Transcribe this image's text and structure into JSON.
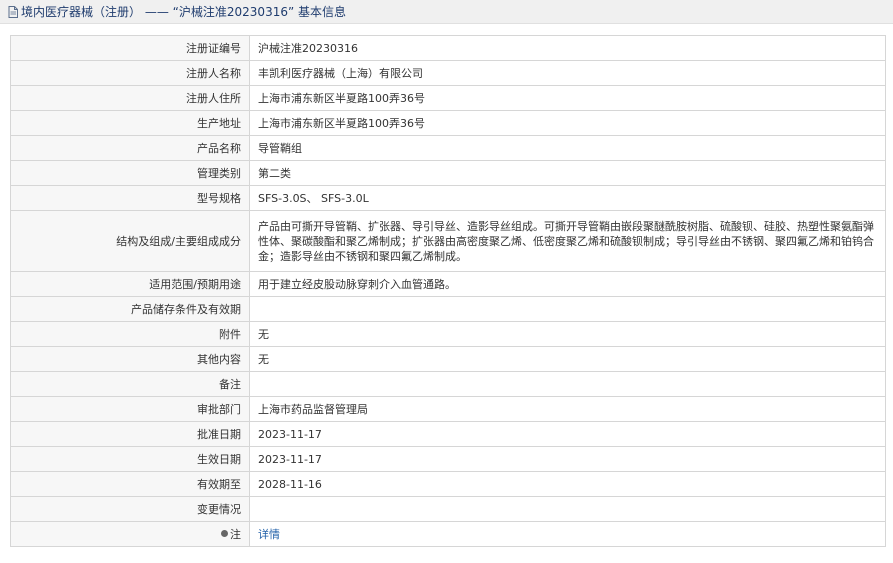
{
  "header": {
    "category": "境内医疗器械（注册）",
    "separator": "——",
    "reg_no_quoted": "“沪械注准20230316”",
    "suffix": "基本信息"
  },
  "rows": [
    {
      "label": "注册证编号",
      "value": "沪械注准20230316"
    },
    {
      "label": "注册人名称",
      "value": "丰凯利医疗器械（上海）有限公司"
    },
    {
      "label": "注册人住所",
      "value": "上海市浦东新区半夏路100弄36号"
    },
    {
      "label": "生产地址",
      "value": "上海市浦东新区半夏路100弄36号"
    },
    {
      "label": "产品名称",
      "value": "导管鞘组"
    },
    {
      "label": "管理类别",
      "value": "第二类"
    },
    {
      "label": "型号规格",
      "value": "SFS-3.0S、 SFS-3.0L"
    },
    {
      "label": "结构及组成/主要组成成分",
      "value": "产品由可撕开导管鞘、扩张器、导引导丝、造影导丝组成。可撕开导管鞘由嵌段聚醚酰胺树脂、硫酸钡、硅胶、热塑性聚氨酯弹性体、聚碳酸酯和聚乙烯制成；扩张器由高密度聚乙烯、低密度聚乙烯和硫酸钡制成；导引导丝由不锈钢、聚四氟乙烯和铂钨合金；造影导丝由不锈钢和聚四氟乙烯制成。"
    },
    {
      "label": "适用范围/预期用途",
      "value": "用于建立经皮股动脉穿刺介入血管通路。"
    },
    {
      "label": "产品储存条件及有效期",
      "value": ""
    },
    {
      "label": "附件",
      "value": "无"
    },
    {
      "label": "其他内容",
      "value": "无"
    },
    {
      "label": "备注",
      "value": ""
    },
    {
      "label": "审批部门",
      "value": "上海市药品监督管理局"
    },
    {
      "label": "批准日期",
      "value": "2023-11-17"
    },
    {
      "label": "生效日期",
      "value": "2023-11-17"
    },
    {
      "label": "有效期至",
      "value": "2028-11-16"
    },
    {
      "label": "变更情况",
      "value": ""
    }
  ],
  "note_row": {
    "label": "注",
    "link": "详情",
    "icon": "note-icon"
  },
  "colors": {
    "header_text": "#1f3c6e",
    "link": "#1f5fa8",
    "label_bg": "#f7f7f7",
    "border": "#d6d6d6"
  }
}
